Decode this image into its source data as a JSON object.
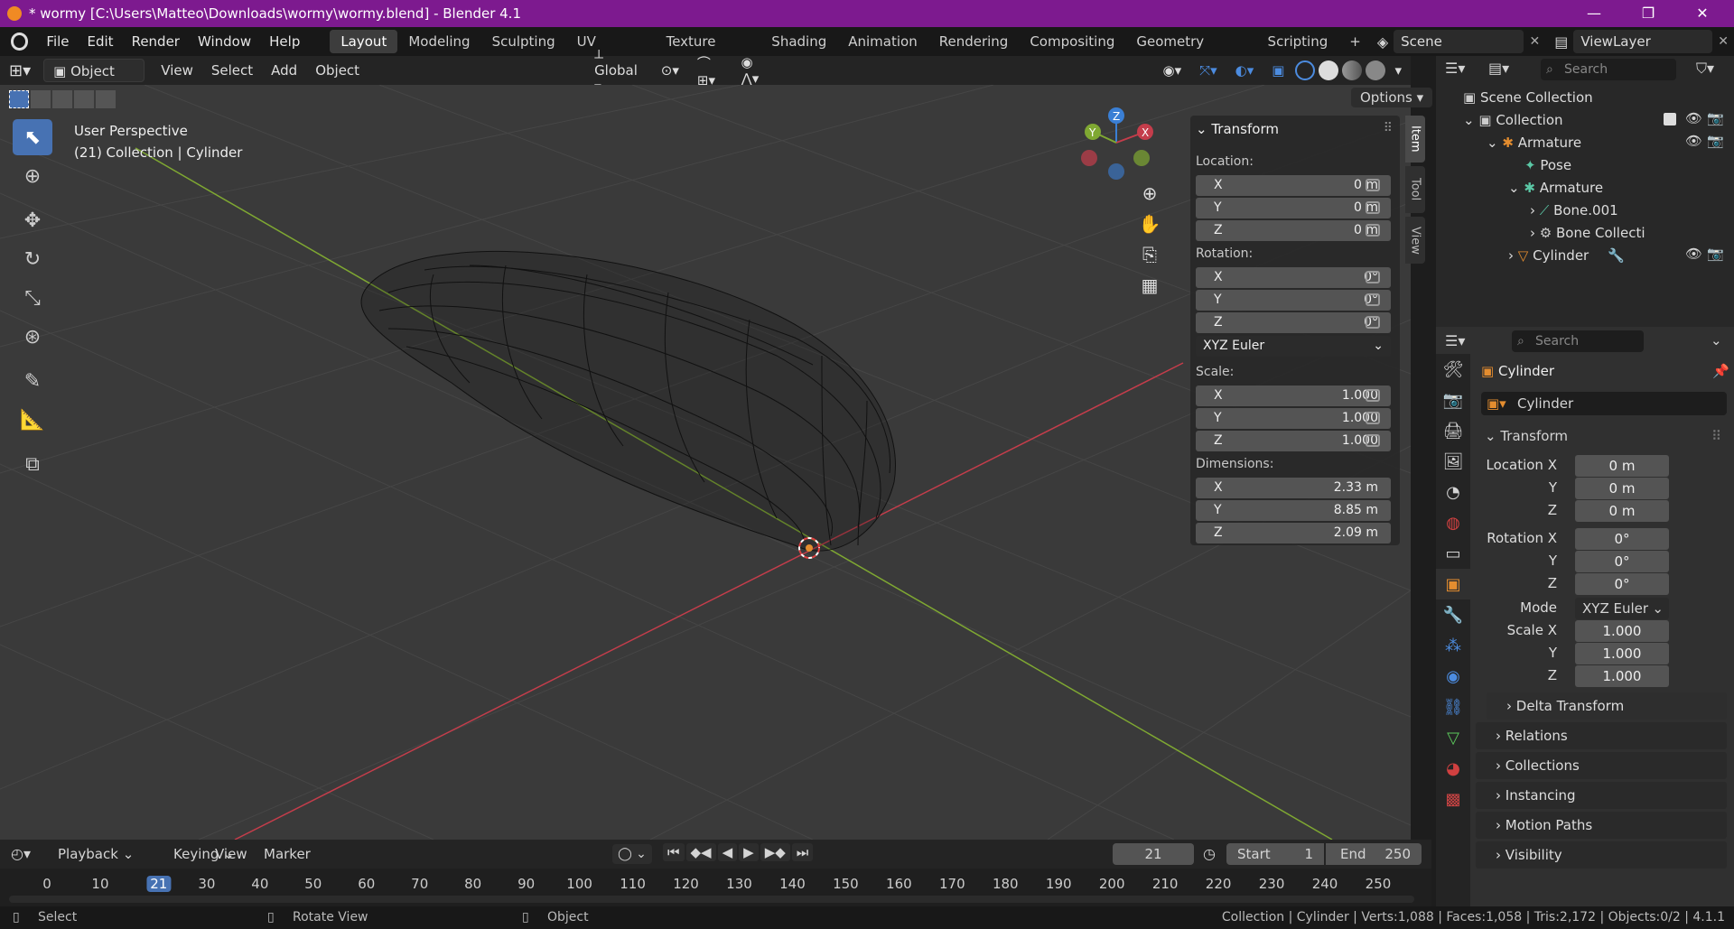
{
  "titlebar": {
    "title": "* wormy [C:\\Users\\Matteo\\Downloads\\wormy\\wormy.blend] - Blender 4.1",
    "minimize": "—",
    "maximize": "❐",
    "close": "✕"
  },
  "menus": [
    "File",
    "Edit",
    "Render",
    "Window",
    "Help"
  ],
  "workspaces": [
    "Layout",
    "Modeling",
    "Sculpting",
    "UV Editing",
    "Texture Paint",
    "Shading",
    "Animation",
    "Rendering",
    "Compositing",
    "Geometry Nodes",
    "Scripting"
  ],
  "workspace_add": "+",
  "scene": {
    "name": "Scene",
    "view_layer": "ViewLayer"
  },
  "viewport_header": {
    "mode": "Object Mode",
    "menus": [
      "View",
      "Select",
      "Add",
      "Object"
    ],
    "orientation": "Global",
    "options": "Options"
  },
  "viewport": {
    "perspective": "User Perspective",
    "context": "(21) Collection | Cylinder"
  },
  "gizmo": {
    "z": "Z",
    "y": "Y",
    "x": "X"
  },
  "npanel": {
    "title": "Transform",
    "location_label": "Location:",
    "location": {
      "x": "0 m",
      "y": "0 m",
      "z": "0 m"
    },
    "rotation_label": "Rotation:",
    "rotation": {
      "x": "0°",
      "y": "0°",
      "z": "0°"
    },
    "rotation_mode": "XYZ Euler",
    "scale_label": "Scale:",
    "scale": {
      "x": "1.000",
      "y": "1.000",
      "z": "1.000"
    },
    "dimensions_label": "Dimensions:",
    "dimensions": {
      "x": "2.33 m",
      "y": "8.85 m",
      "z": "2.09 m"
    },
    "axes": {
      "x": "X",
      "y": "Y",
      "z": "Z"
    },
    "tabs": [
      "Item",
      "Tool",
      "View"
    ]
  },
  "outliner": {
    "search_placeholder": "Search",
    "items": [
      "Scene Collection",
      "Collection",
      "Armature",
      "Pose",
      "Armature",
      "Bone.001",
      "Bone Collecti",
      "Cylinder"
    ]
  },
  "properties": {
    "search_placeholder": "Search",
    "object_name": "Cylinder",
    "object_field": "Cylinder",
    "transform_title": "Transform",
    "location_x_label": "Location X",
    "y_label": "Y",
    "z_label": "Z",
    "location": {
      "x": "0 m",
      "y": "0 m",
      "z": "0 m"
    },
    "rotation_x_label": "Rotation X",
    "rotation": {
      "x": "0°",
      "y": "0°",
      "z": "0°"
    },
    "mode_label": "Mode",
    "mode": "XYZ Euler",
    "scale_x_label": "Scale X",
    "scale": {
      "x": "1.000",
      "y": "1.000",
      "z": "1.000"
    },
    "sections": [
      "Delta Transform",
      "Relations",
      "Collections",
      "Instancing",
      "Motion Paths",
      "Visibility"
    ]
  },
  "timeline": {
    "menus": [
      "Playback",
      "Keying",
      "View",
      "Marker"
    ],
    "current_frame": "21",
    "start_label": "Start",
    "start": "1",
    "end_label": "End",
    "end": "250",
    "ticks": [
      "0",
      "10",
      "21",
      "30",
      "40",
      "50",
      "60",
      "70",
      "80",
      "90",
      "100",
      "110",
      "120",
      "130",
      "140",
      "150",
      "160",
      "170",
      "180",
      "190",
      "200",
      "210",
      "220",
      "230",
      "240",
      "250"
    ]
  },
  "statusbar": {
    "select": "Select",
    "rotate": "Rotate View",
    "object": "Object",
    "info": "Collection | Cylinder | Verts:1,088 | Faces:1,058 | Tris:2,172 | Objects:0/2 | 4.1.1"
  },
  "colors": {
    "titlebar": "#7d1a8f",
    "accent": "#4772b3",
    "x_axis": "#c43d4b",
    "y_axis": "#7fa832",
    "z_axis": "#3a7fd5",
    "object": "#e48d2f"
  }
}
